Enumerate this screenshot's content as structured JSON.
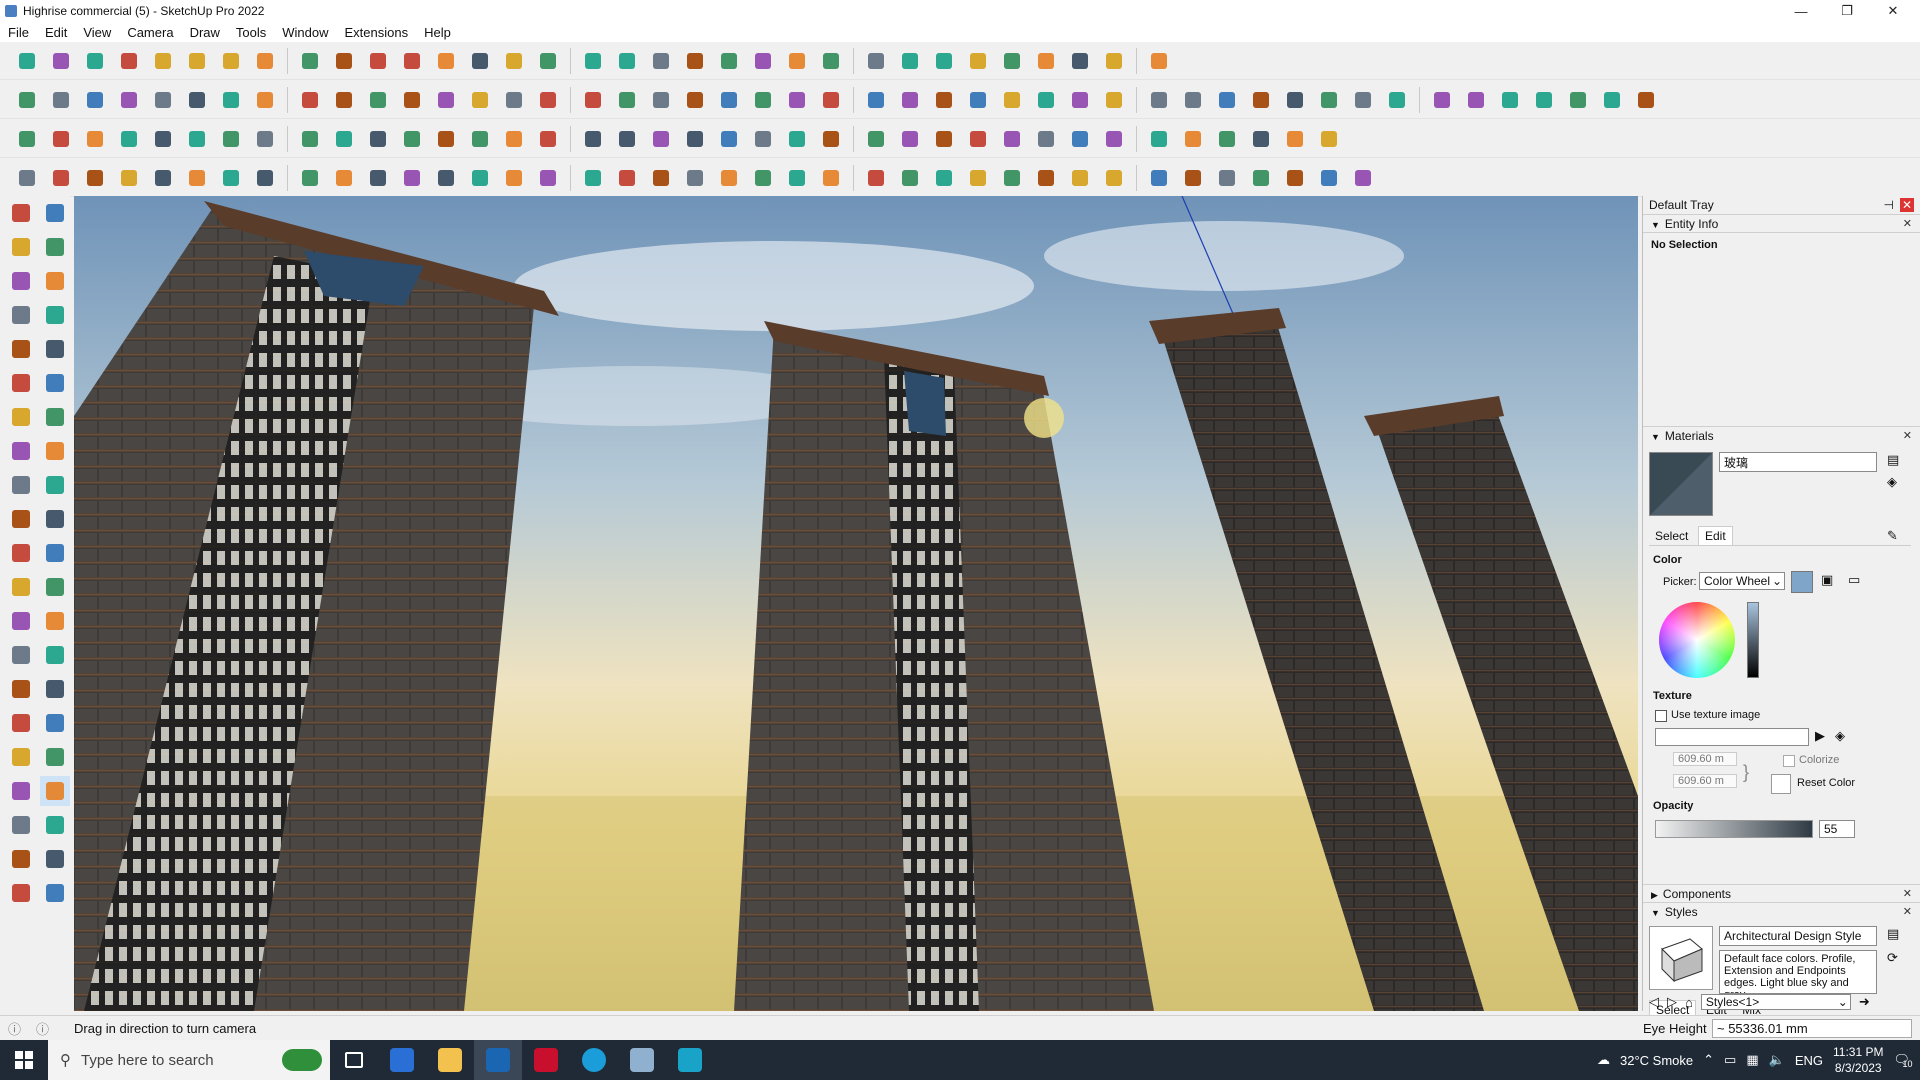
{
  "window": {
    "title": "Highrise commercial (5) - SketchUp Pro 2022",
    "controls": [
      "—",
      "❐",
      "✕"
    ]
  },
  "menu": [
    "File",
    "Edit",
    "View",
    "Camera",
    "Draw",
    "Tools",
    "Window",
    "Extensions",
    "Help"
  ],
  "toolbar_icons": {
    "row1": [
      "zoom-extents-icon",
      "select-icon",
      "eraser-icon",
      "pencil-icon",
      "lasso-icon",
      "paint-bucket-icon",
      "push-pull-icon",
      "follow-me-icon",
      "move-icon",
      "rotate-icon",
      "scale-icon",
      "tape-measure-icon",
      "text-icon",
      "paint-icon",
      "orbit-icon",
      "pan-icon",
      "zoom-icon",
      "zoom-window-icon",
      "section-icon",
      "layers-icon",
      "outliner-icon",
      "scenes-icon",
      "user-icon",
      "warehouse-icon",
      "extension-icon",
      "sandbox-icon",
      "flip-icon",
      "mirror-icon",
      "axes-icon",
      "fit-icon",
      "undo-icon",
      "redo-icon",
      "ruby-icon"
    ],
    "row2": [
      "iso-view-icon",
      "top-view-icon",
      "front-view-icon",
      "right-view-icon",
      "back-view-icon",
      "left-view-icon",
      "xray-icon",
      "wireframe-icon",
      "hidden-line-icon",
      "shaded-icon",
      "textures-icon",
      "monochrome-icon",
      "arc-icon",
      "move-red-icon",
      "move-blue-icon",
      "move-green-icon",
      "scale-x-icon",
      "scale-y-icon",
      "scale-z-icon",
      "flip-x-icon",
      "flip-y-icon",
      "house-icon",
      "house-outline-icon",
      "garage-icon",
      "tent-icon",
      "barn-icon",
      "solid-icon",
      "group-icon",
      "cut-icon",
      "union-icon",
      "intersect-icon",
      "trim-icon",
      "split-icon",
      "fx-icon",
      "tape-icon",
      "eraser-2-icon",
      "circle-icon",
      "ellipse-icon",
      "polygon-icon",
      "curve-icon",
      "rotate-3d-icon",
      "bezier-icon",
      "spline-icon",
      "tag-icon",
      "shield-icon",
      "measure-icon",
      "brush-icon"
    ],
    "row3": [
      "cube-red-icon",
      "diamond-blue-icon",
      "diamond-yellow-icon",
      "diamond-green-icon",
      "diamond-grey-icon",
      "gem-red-icon",
      "arc-orange-icon",
      "square-red-icon",
      "grid-icon",
      "panel-icon",
      "link-icon",
      "chain-icon",
      "bracket-icon",
      "curve-red-icon",
      "plus-red-icon",
      "plus-green-icon",
      "x-blue-icon",
      "triangle-blue-icon",
      "flame-icon",
      "warning-icon",
      "spiral-icon",
      "spiral-2-icon",
      "target-icon",
      "star-icon",
      "bucket-icon",
      "loop-icon",
      "frame-icon",
      "gear-icon",
      "share-icon",
      "cube-icon",
      "sphere-icon",
      "people-icon",
      "window-icon",
      "grid-orange-icon",
      "waffle-icon",
      "crosshair-icon",
      "lasso-dashed-icon",
      "matrix-icon"
    ],
    "row4": [
      "spline-tool-icon",
      "dotted-curve-icon",
      "vehicle-icon",
      "scissors-icon",
      "gear-outline-icon",
      "shape-icon",
      "coil-icon",
      "box-icon",
      "hand-icon",
      "fan-icon",
      "rail-icon",
      "rail-2-icon",
      "line-red-icon",
      "curve-outline-icon",
      "cylinder-icon",
      "cone-icon",
      "comb-icon",
      "tube-icon",
      "hand-grab-icon",
      "leaf-icon",
      "arrow-left-icon",
      "stack-icon",
      "stripe-icon",
      "split-lines-icon",
      "split-lines-2-icon",
      "split-lines-3-icon",
      "arch-icon",
      "stairs-icon",
      "door-icon",
      "door-2-icon",
      "columns-icon",
      "mesh-icon",
      "grid-lines-icon",
      "bars-icon",
      "gear-dark-icon",
      "cog-icon",
      "slope-icon",
      "fence-icon",
      "shell-icon"
    ]
  },
  "viewport": {
    "description_free": true
  },
  "tray": {
    "title": "Default Tray",
    "entity_info": {
      "label": "Entity Info",
      "selection": "No Selection"
    },
    "materials": {
      "label": "Materials",
      "name": "玻璃",
      "tabs": [
        "Select",
        "Edit"
      ],
      "color_heading": "Color",
      "picker_label": "Picker:",
      "picker_value": "Color Wheel",
      "texture_heading": "Texture",
      "use_texture": "Use texture image",
      "width": "609.60 m",
      "height": "609.60 m",
      "colorize": "Colorize",
      "reset_color": "Reset Color",
      "opacity_heading": "Opacity",
      "opacity_value": "55",
      "swatch_color": "#3a4a55"
    },
    "components": {
      "label": "Components"
    },
    "styles": {
      "label": "Styles",
      "name": "Architectural Design Style",
      "description": "Default face colors. Profile, Extension and Endpoints edges. Light blue sky and gray",
      "tabs": [
        "Select",
        "Edit",
        "Mix"
      ],
      "collection": "Styles<1>"
    }
  },
  "status": {
    "message": "Drag in direction to turn camera",
    "eye_label": "Eye Height",
    "eye_value": "~ 55336.01 mm"
  },
  "taskbar": {
    "search_placeholder": "Type here to search",
    "weather": "32°C  Smoke",
    "lang": "ENG",
    "time": "11:31 PM",
    "date": "8/3/2023",
    "notifications": "10"
  }
}
